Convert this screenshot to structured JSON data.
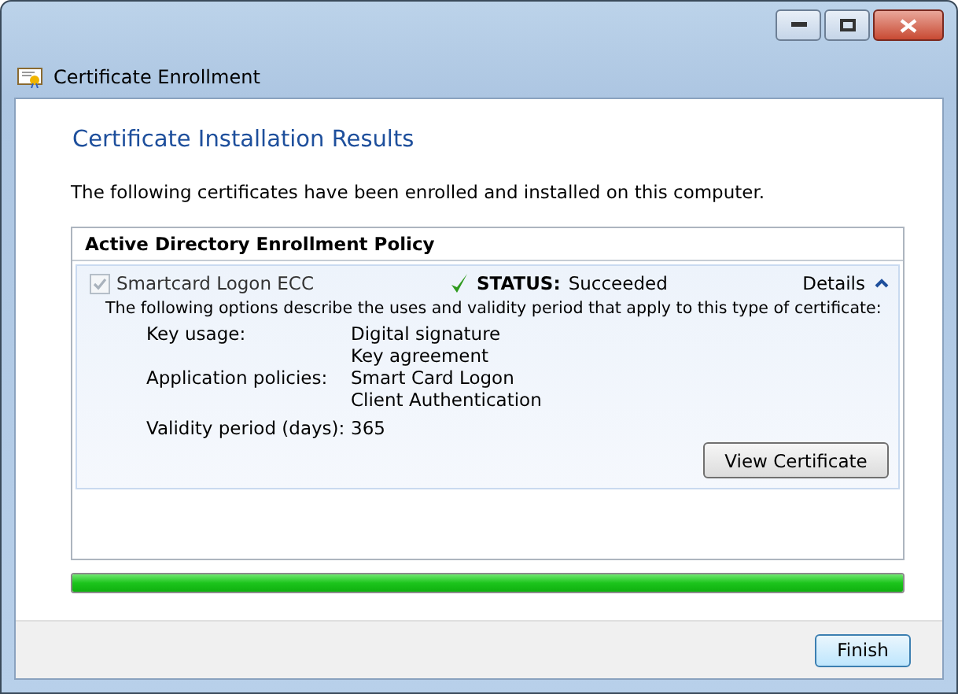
{
  "window": {
    "title": "Certificate Enrollment"
  },
  "heading": "Certificate Installation Results",
  "intro": "The following certificates have been enrolled and installed on this computer.",
  "policy": {
    "name": "Active Directory Enrollment Policy",
    "certificates": [
      {
        "name": "Smartcard Logon ECC",
        "checked": true,
        "disabled": true,
        "status_label": "STATUS:",
        "status": "Succeeded",
        "details_label": "Details",
        "expanded": true,
        "description": "The following options describe the uses and validity period that apply to this type of certificate:",
        "properties": [
          {
            "label": "Key usage:",
            "values": [
              "Digital signature",
              "Key agreement"
            ]
          },
          {
            "label": "Application policies:",
            "values": [
              "Smart Card Logon",
              "Client Authentication"
            ]
          },
          {
            "label": "Validity period (days):",
            "values": [
              "365"
            ]
          }
        ],
        "button": "View Certificate"
      }
    ]
  },
  "progress": {
    "level": 1
  },
  "buttons": [
    "Finish"
  ]
}
